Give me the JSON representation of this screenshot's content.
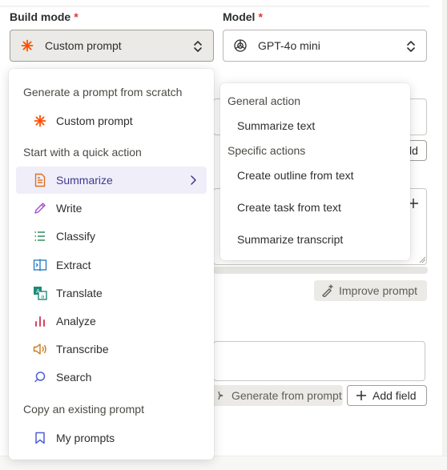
{
  "build_mode": {
    "label": "Build mode",
    "required_mark": "*",
    "selected": "Custom prompt"
  },
  "model": {
    "label": "Model",
    "required_mark": "*",
    "selected": "GPT-4o mini"
  },
  "background": {
    "field_btn_fragment": "ld",
    "improve_prompt": "Improve prompt",
    "generate_from_prompt": "Generate from prompt",
    "add_field": "Add field"
  },
  "menu": {
    "section_scratch": "Generate a prompt from scratch",
    "custom_prompt": "Custom prompt",
    "section_quick": "Start with a quick action",
    "quick_actions": [
      {
        "label": "Summarize",
        "icon": "document-icon"
      },
      {
        "label": "Write",
        "icon": "pencil-icon"
      },
      {
        "label": "Classify",
        "icon": "list-icon"
      },
      {
        "label": "Extract",
        "icon": "extract-icon"
      },
      {
        "label": "Translate",
        "icon": "translate-icon"
      },
      {
        "label": "Analyze",
        "icon": "bar-chart-icon"
      },
      {
        "label": "Transcribe",
        "icon": "speaker-icon"
      },
      {
        "label": "Search",
        "icon": "search-icon"
      }
    ],
    "section_copy": "Copy an existing prompt",
    "my_prompts": "My prompts"
  },
  "submenu": {
    "section_general": "General action",
    "general_items": [
      "Summarize text"
    ],
    "section_specific": "Specific actions",
    "specific_items": [
      "Create outline from text",
      "Create task from text",
      "Summarize transcript"
    ]
  },
  "colors": {
    "accent_orange": "#ff4f00",
    "highlight_bg": "#f0eef9",
    "highlight_text": "#3d3a8f",
    "required_red": "#e1382f"
  }
}
